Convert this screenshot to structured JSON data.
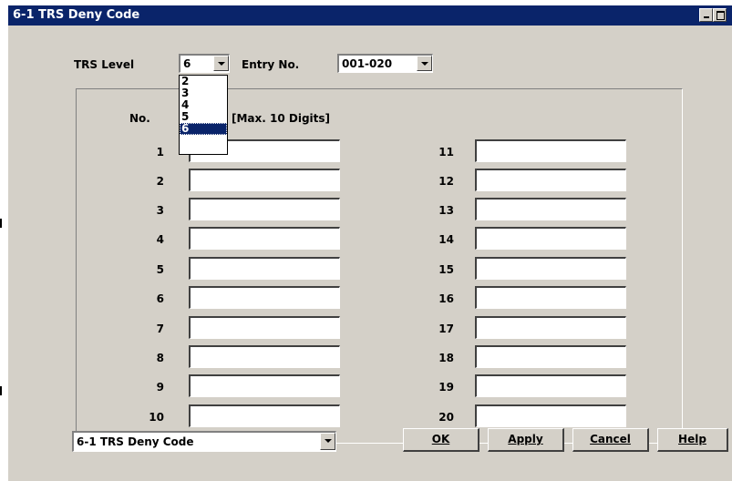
{
  "window": {
    "title": "6-1 TRS Deny Code"
  },
  "header": {
    "trs_level_label": "TRS Level",
    "trs_level_value": "6",
    "entry_no_label": "Entry No.",
    "entry_no_value": "001-020"
  },
  "dropdown": {
    "options": [
      "2",
      "3",
      "4",
      "5",
      "6"
    ],
    "selected": "6"
  },
  "table": {
    "no_header": "No.",
    "max_header": "[Max. 10 Digits]",
    "left_rows": [
      "1",
      "2",
      "3",
      "4",
      "5",
      "6",
      "7",
      "8",
      "9",
      "10"
    ],
    "right_rows": [
      "11",
      "12",
      "13",
      "14",
      "15",
      "16",
      "17",
      "18",
      "19",
      "20"
    ]
  },
  "footer": {
    "nav_value": "6-1 TRS Deny Code",
    "ok_label": "OK",
    "apply_label": "Apply",
    "cancel_label": "Cancel",
    "help_label": "Help"
  },
  "colors": {
    "titlebar": "#0a246a",
    "face": "#d4d0c8",
    "selection": "#0a246a"
  }
}
